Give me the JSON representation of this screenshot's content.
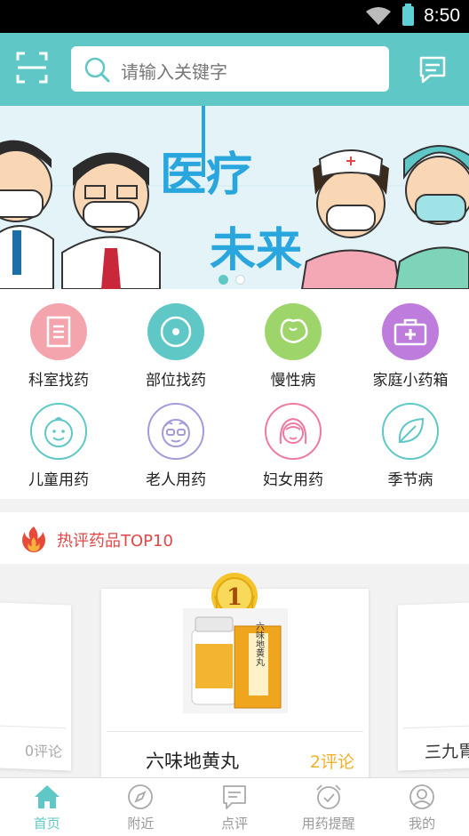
{
  "status_bar": {
    "time": "8:50"
  },
  "search": {
    "placeholder": "请输入关键字"
  },
  "banner": {
    "headline_line1": "医疗",
    "headline_line2": "未来",
    "slide_count": 2,
    "active_slide": 1
  },
  "categories": [
    {
      "label": "科室找药",
      "icon": "document-icon",
      "color": "#f4a4ad"
    },
    {
      "label": "部位找药",
      "icon": "target-icon",
      "color": "#5fc8c6"
    },
    {
      "label": "慢性病",
      "icon": "organ-icon",
      "color": "#9dd56a"
    },
    {
      "label": "家庭小药箱",
      "icon": "medkit-icon",
      "color": "#be7ddd"
    },
    {
      "label": "儿童用药",
      "icon": "baby-face-icon",
      "color": "#5fc8c6"
    },
    {
      "label": "老人用药",
      "icon": "elder-face-icon",
      "color": "#a69ad9"
    },
    {
      "label": "妇女用药",
      "icon": "woman-face-icon",
      "color": "#ef7aa0"
    },
    {
      "label": "季节病",
      "icon": "leaf-icon",
      "color": "#5fc8c6"
    }
  ],
  "hot_section": {
    "title": "热评药品TOP10"
  },
  "products": {
    "left": {
      "comments": "0评论"
    },
    "center": {
      "rank": "1",
      "name": "六味地黄丸",
      "comments": "2评论",
      "box_text": "六味地黄丸"
    },
    "right": {
      "name": "三九胃"
    }
  },
  "tabs": [
    {
      "label": "首页",
      "icon": "home-icon",
      "active": true
    },
    {
      "label": "附近",
      "icon": "compass-icon",
      "active": false
    },
    {
      "label": "点评",
      "icon": "comment-icon",
      "active": false
    },
    {
      "label": "用药提醒",
      "icon": "alarm-clock-icon",
      "active": false
    },
    {
      "label": "我的",
      "icon": "profile-icon",
      "active": false
    }
  ],
  "colors": {
    "primary": "#5fc8c6",
    "hot_title": "#e24646",
    "comments": "#f0b02a"
  }
}
